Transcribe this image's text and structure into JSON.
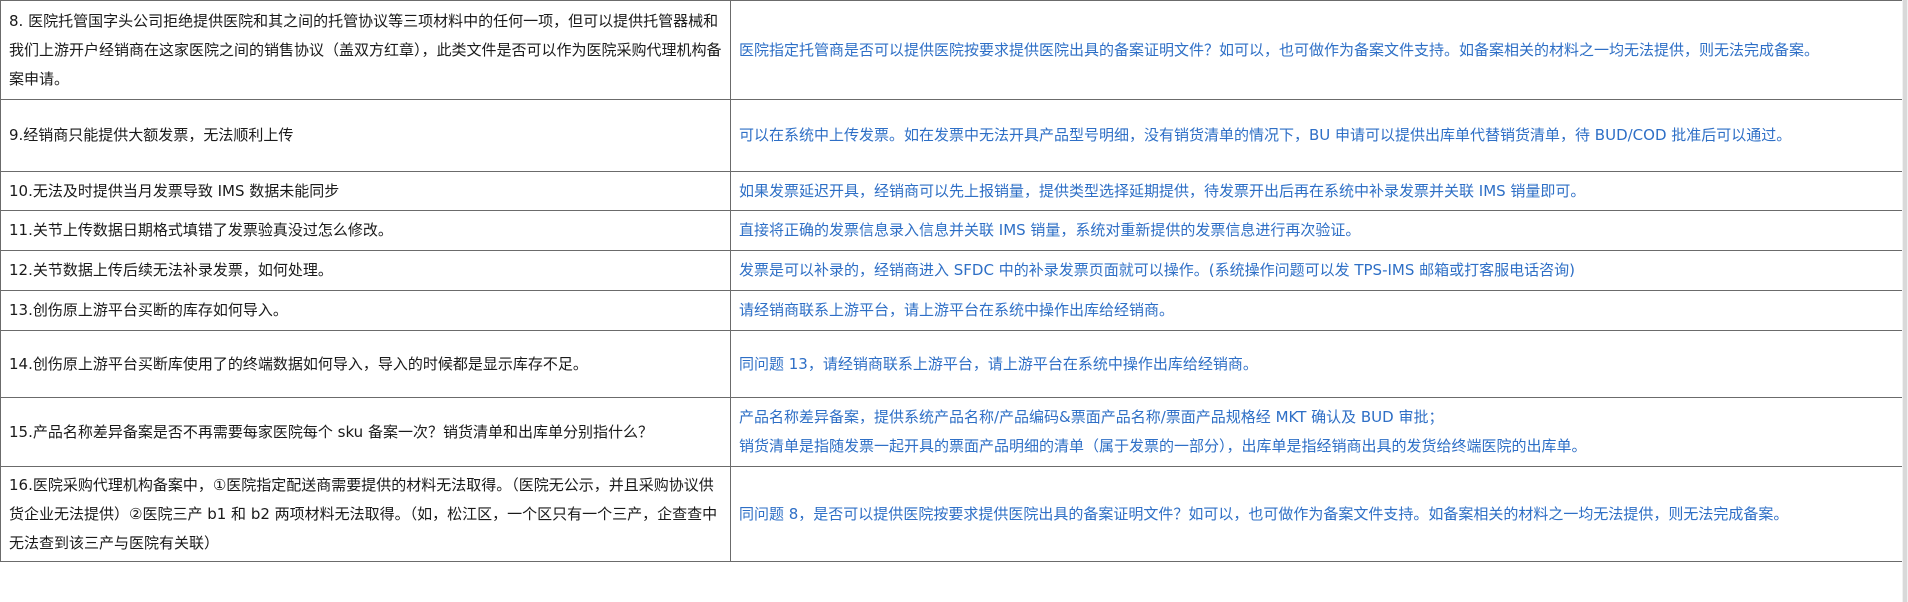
{
  "table": {
    "rows": [
      {
        "question": "8. 医院托管国字头公司拒绝提供医院和其之间的托管协议等三项材料中的任何一项，但可以提供托管器械和我们上游开户经销商在这家医院之间的销售协议（盖双方红章），此类文件是否可以作为医院采购代理机构备案申请。",
        "answer": [
          "医院指定托管商是否可以提供医院按要求提供医院出具的备案证明文件？如可以，也可做作为备案文件支持。如备案相关的材料之一均无法提供，则无法完成备案。"
        ]
      },
      {
        "question": "9.经销商只能提供大额发票，无法顺利上传",
        "answer": [
          "可以在系统中上传发票。如在发票中无法开具产品型号明细，没有销货清单的情况下，BU 申请可以提供出库单代替销货清单，待 BUD/COD 批准后可以通过。"
        ]
      },
      {
        "question": "10.无法及时提供当月发票导致 IMS 数据未能同步",
        "answer": [
          "如果发票延迟开具，经销商可以先上报销量，提供类型选择延期提供，待发票开出后再在系统中补录发票并关联 IMS 销量即可。"
        ]
      },
      {
        "question": "11.关节上传数据日期格式填错了发票验真没过怎么修改。",
        "answer": [
          "直接将正确的发票信息录入信息并关联 IMS 销量，系统对重新提供的发票信息进行再次验证。"
        ]
      },
      {
        "question": "12.关节数据上传后续无法补录发票，如何处理。",
        "answer": [
          "发票是可以补录的，经销商进入 SFDC 中的补录发票页面就可以操作。(系统操作问题可以发 TPS-IMS 邮箱或打客服电话咨询)"
        ]
      },
      {
        "question": "13.创伤原上游平台买断的库存如何导入。",
        "answer": [
          "请经销商联系上游平台，请上游平台在系统中操作出库给经销商。"
        ]
      },
      {
        "question": "14.创伤原上游平台买断库使用了的终端数据如何导入，导入的时候都是显示库存不足。",
        "answer": [
          "同问题 13，请经销商联系上游平台，请上游平台在系统中操作出库给经销商。"
        ]
      },
      {
        "question": "15.产品名称差异备案是否不再需要每家医院每个 sku 备案一次？销货清单和出库单分别指什么？",
        "answer": [
          "产品名称差异备案，提供系统产品名称/产品编码&票面产品名称/票面产品规格经 MKT 确认及 BUD 审批；",
          "销货清单是指随发票一起开具的票面产品明细的清单（属于发票的一部分），出库单是指经销商出具的发货给终端医院的出库单。"
        ]
      },
      {
        "question": "16.医院采购代理机构备案中，①医院指定配送商需要提供的材料无法取得。（医院无公示，并且采购协议供货企业无法提供）②医院三产 b1 和 b2 两项材料无法取得。（如，松江区，一个区只有一个三产，企查查中无法查到该三产与医院有关联）",
        "answer": [
          "同问题 8，是否可以提供医院按要求提供医院出具的备案证明文件？如可以，也可做作为备案文件支持。如备案相关的材料之一均无法提供，则无法完成备案。"
        ]
      }
    ]
  }
}
